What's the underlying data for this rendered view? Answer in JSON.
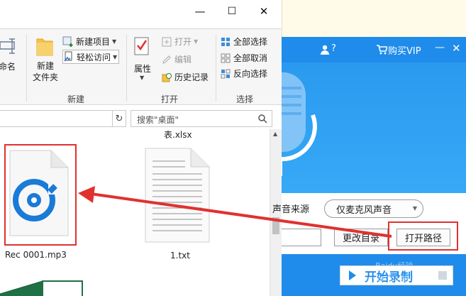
{
  "explorer": {
    "window_controls": {
      "minimize": "—",
      "maximize": "☐",
      "close": "✕"
    },
    "ribbon": {
      "partial_left_label": "重命名",
      "new_folder_label": "新建\n文件夹",
      "new_item_label": "新建项目",
      "easy_access_label": "轻松访问",
      "group_new": "新建",
      "properties_label": "属性",
      "open_label": "打开",
      "edit_label": "编辑",
      "history_label": "历史记录",
      "group_open": "打开",
      "select_all_label": "全部选择",
      "select_none_label": "全部取消",
      "invert_select_label": "反向选择",
      "group_select": "选择"
    },
    "address": {
      "dropdown_glyph": "∨",
      "refresh_glyph": "↻",
      "search_placeholder": "搜索\"桌面\""
    },
    "files": [
      {
        "name": "Rec 0001.mp3",
        "icon": "groove-music-icon"
      },
      {
        "name": "1.txt",
        "icon": "text-file-icon"
      }
    ],
    "partial_top_file": "表.xlsx"
  },
  "recorder": {
    "header_help": "?",
    "buy_vip_label": "购买VIP",
    "minimize_glyph": "—",
    "close_glyph": "✕",
    "source_label": "声音来源",
    "source_value": "仅麦克风声音",
    "change_dir_label": "更改目录",
    "open_path_label": "打开路径",
    "start_record_label": "开始录制",
    "watermark": "Baidu经验\njingyan.baidu.com"
  },
  "colors": {
    "accent_blue": "#1f8ceb",
    "highlight_red": "#e0312f"
  }
}
